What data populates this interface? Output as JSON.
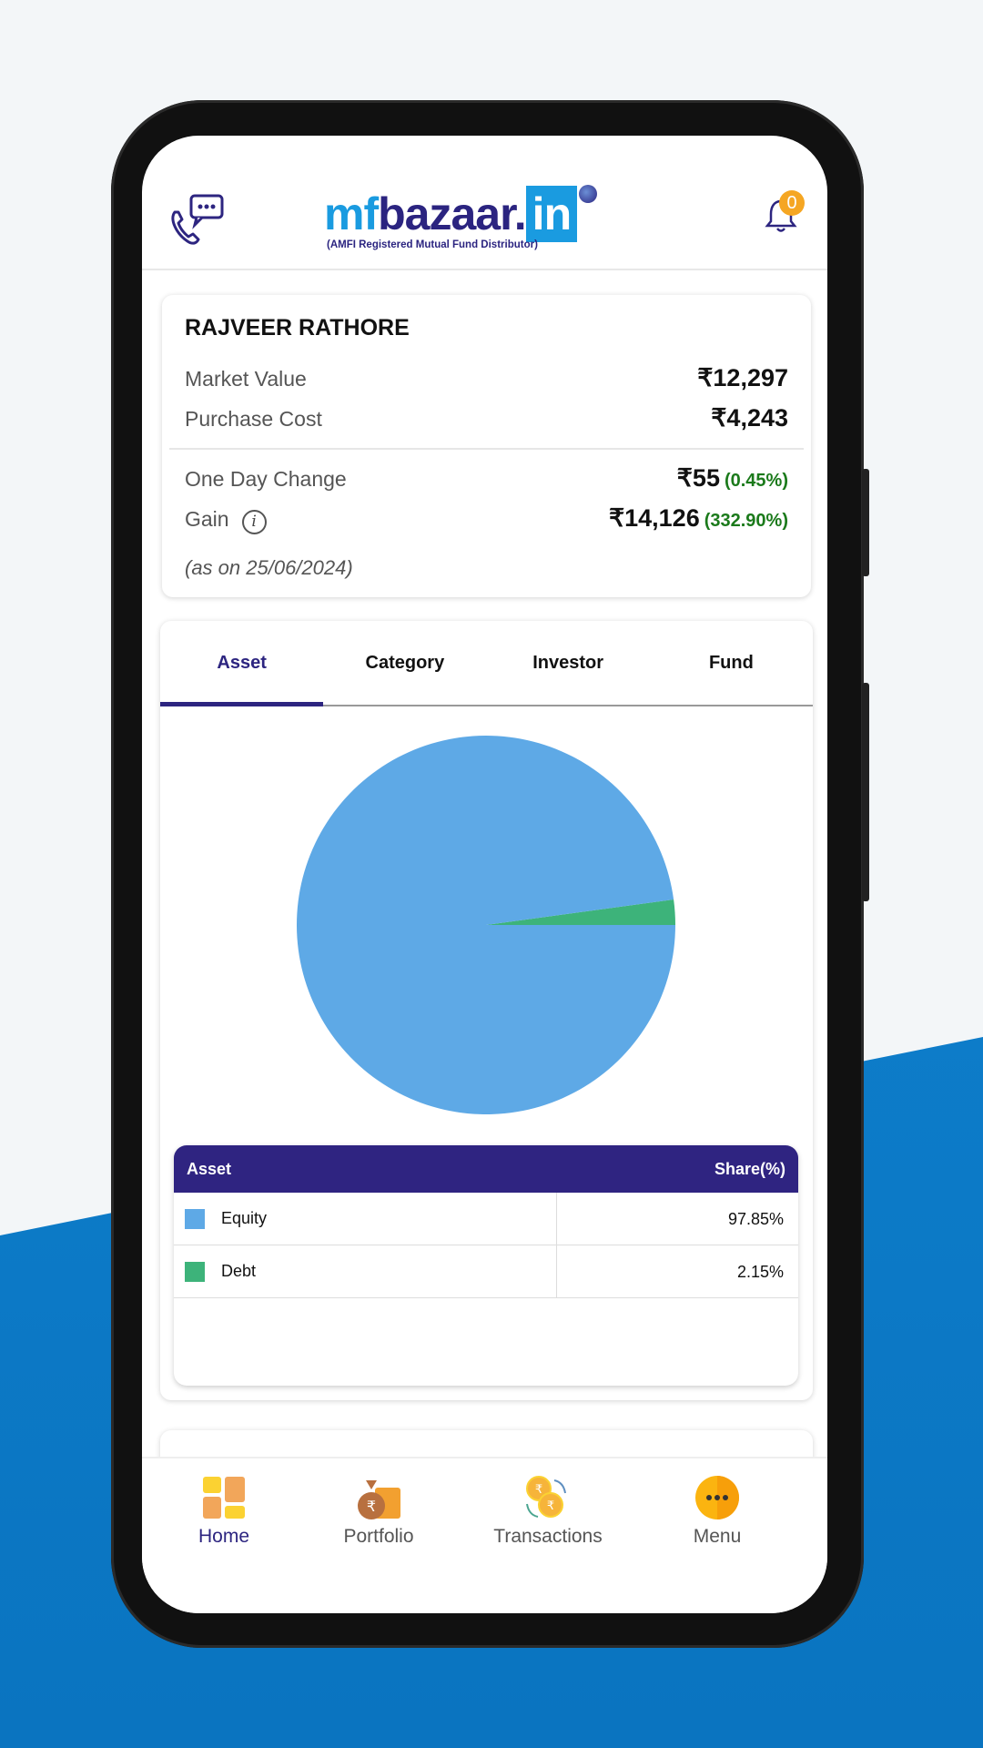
{
  "header": {
    "logo_text": "mfbazaar.in",
    "logo_subtitle": "(AMFI Registered Mutual Fund Distributor)",
    "notification_count": "0"
  },
  "summary": {
    "name": "RAJVEER RATHORE",
    "market_value_label": "Market Value",
    "market_value": "₹12,297",
    "purchase_cost_label": "Purchase Cost",
    "purchase_cost": "₹4,243",
    "one_day_change_label": "One Day Change",
    "one_day_change": "₹55",
    "one_day_change_pct": "(0.45%)",
    "gain_label": "Gain",
    "gain": "₹14,126",
    "gain_pct": "(332.90%)",
    "as_on": "(as on 25/06/2024)"
  },
  "tabs": [
    {
      "label": "Asset",
      "active": true
    },
    {
      "label": "Category"
    },
    {
      "label": "Investor"
    },
    {
      "label": "Fund"
    }
  ],
  "chart_data": {
    "type": "pie",
    "categories": [
      "Equity",
      "Debt"
    ],
    "values": [
      97.85,
      2.15
    ],
    "colors": [
      "#5ea9e6",
      "#3db37a"
    ]
  },
  "table": {
    "headers": [
      "Asset",
      "Share(%)"
    ],
    "rows": [
      {
        "asset": "Equity",
        "share": "97.85%"
      },
      {
        "asset": "Debt",
        "share": "2.15%"
      }
    ]
  },
  "nav": [
    {
      "label": "Home",
      "active": true
    },
    {
      "label": "Portfolio"
    },
    {
      "label": "Transactions"
    },
    {
      "label": "Menu"
    }
  ]
}
